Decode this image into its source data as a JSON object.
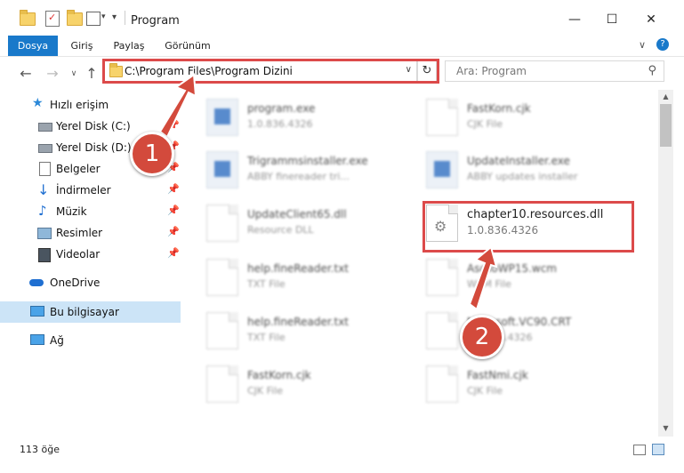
{
  "window": {
    "title": "Program"
  },
  "ribbon": {
    "tabs": [
      "Dosya",
      "Giriş",
      "Paylaş",
      "Görünüm"
    ]
  },
  "address": {
    "path": "C:\\Program Files\\Program Dizini"
  },
  "search": {
    "placeholder": "Ara: Program"
  },
  "sidebar": {
    "items": [
      {
        "label": "Hızlı erişim",
        "icon": "star-icon"
      },
      {
        "label": "Yerel Disk (C:)",
        "icon": "drive-icon",
        "pinned": true
      },
      {
        "label": "Yerel Disk (D:)",
        "icon": "drive-icon",
        "pinned": true
      },
      {
        "label": "Belgeler",
        "icon": "documents-icon",
        "pinned": true
      },
      {
        "label": "İndirmeler",
        "icon": "downloads-icon",
        "pinned": true
      },
      {
        "label": "Müzik",
        "icon": "music-icon",
        "pinned": true
      },
      {
        "label": "Resimler",
        "icon": "pictures-icon",
        "pinned": true
      },
      {
        "label": "Videolar",
        "icon": "videos-icon",
        "pinned": true
      },
      {
        "label": "OneDrive",
        "icon": "cloud-icon"
      },
      {
        "label": "Bu bilgisayar",
        "icon": "computer-icon",
        "selected": true
      },
      {
        "label": "Ağ",
        "icon": "network-icon"
      }
    ]
  },
  "files": [
    {
      "name": "program.exe",
      "sub": "1.0.836.4326"
    },
    {
      "name": "FastKorn.cjk",
      "sub": "CJK File"
    },
    {
      "name": "Trigrammsinstaller.exe",
      "sub": "ABBY finereader tri..."
    },
    {
      "name": "UpdateInstaller.exe",
      "sub": "ABBY updates installer"
    },
    {
      "name": "UpdateClient65.dll",
      "sub": "Resource DLL"
    },
    {
      "name": "chapter10.resources.dll",
      "sub": "1.0.836.4326"
    },
    {
      "name": "help.fineReader.txt",
      "sub": "TXT File"
    },
    {
      "name": "AsdToWP15.wcm",
      "sub": "WCM File"
    },
    {
      "name": "help.fineReader.txt",
      "sub": "TXT File"
    },
    {
      "name": "Microsoft.VC90.CRT",
      "sub": "1.0.836.4326"
    },
    {
      "name": "FastKorn.cjk",
      "sub": "CJK File"
    },
    {
      "name": "FastNmi.cjk",
      "sub": "CJK File"
    }
  ],
  "status": {
    "item_count": "113 öğe"
  },
  "callouts": [
    "1",
    "2"
  ],
  "colors": {
    "accent": "#1979ca",
    "highlight": "#dc4a4a",
    "callout": "#d34a3c"
  }
}
